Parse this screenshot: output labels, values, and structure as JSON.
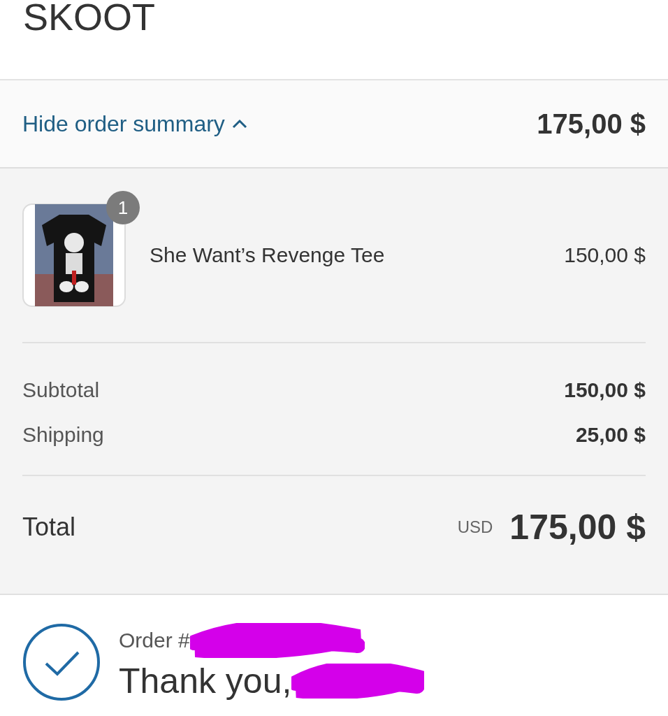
{
  "header": {
    "logo": "SKOOT"
  },
  "summary_toggle": {
    "label": "Hide order summary",
    "expanded": true,
    "total": "175,00 $"
  },
  "items": [
    {
      "quantity": "1",
      "name": "She Want’s Revenge Tee",
      "price": "150,00 $"
    }
  ],
  "costs": [
    {
      "label": "Subtotal",
      "value": "150,00 $"
    },
    {
      "label": "Shipping",
      "value": "25,00 $"
    }
  ],
  "total": {
    "label": "Total",
    "currency": "USD",
    "value": "175,00 $"
  },
  "confirmation": {
    "order_label": "Order #",
    "greeting": "Thank you,"
  }
}
